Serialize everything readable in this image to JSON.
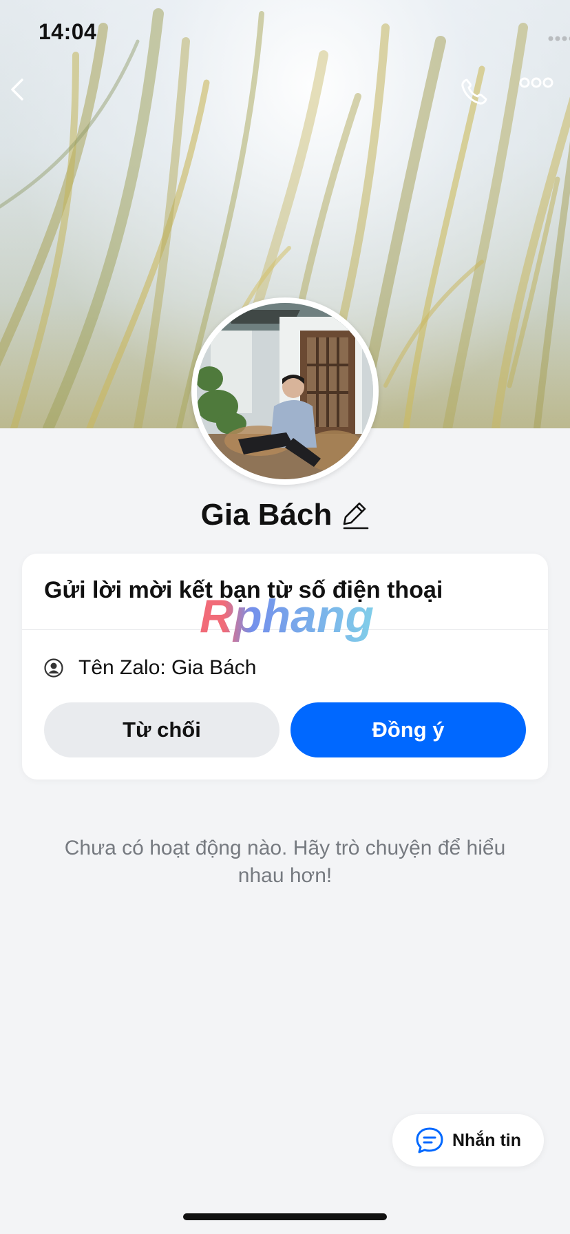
{
  "status_bar": {
    "time": "14:04",
    "signal_icon": "signal-dots-icon",
    "wifi_icon": "wifi-icon",
    "battery_icon": "battery-icon"
  },
  "nav": {
    "back_icon": "chevron-left-icon",
    "call_icon": "phone-icon",
    "more_icon": "more-icon"
  },
  "profile": {
    "name": "Gia Bách",
    "edit_icon": "pencil-icon"
  },
  "friend_request": {
    "title": "Gửi lời mời kết bạn từ số điện thoại",
    "zalo_name_line": "Tên Zalo: Gia Bách",
    "decline_label": "Từ chối",
    "accept_label": "Đồng ý"
  },
  "watermark": "Rphang",
  "empty_state": {
    "message": "Chưa có hoạt động nào. Hãy trò chuyện để hiểu nhau hơn!"
  },
  "fab": {
    "label": "Nhắn tin",
    "icon": "chat-bubble-icon"
  },
  "colors": {
    "accent": "#0068ff",
    "background": "#f3f4f6",
    "decline_bg": "#e9ebee"
  }
}
